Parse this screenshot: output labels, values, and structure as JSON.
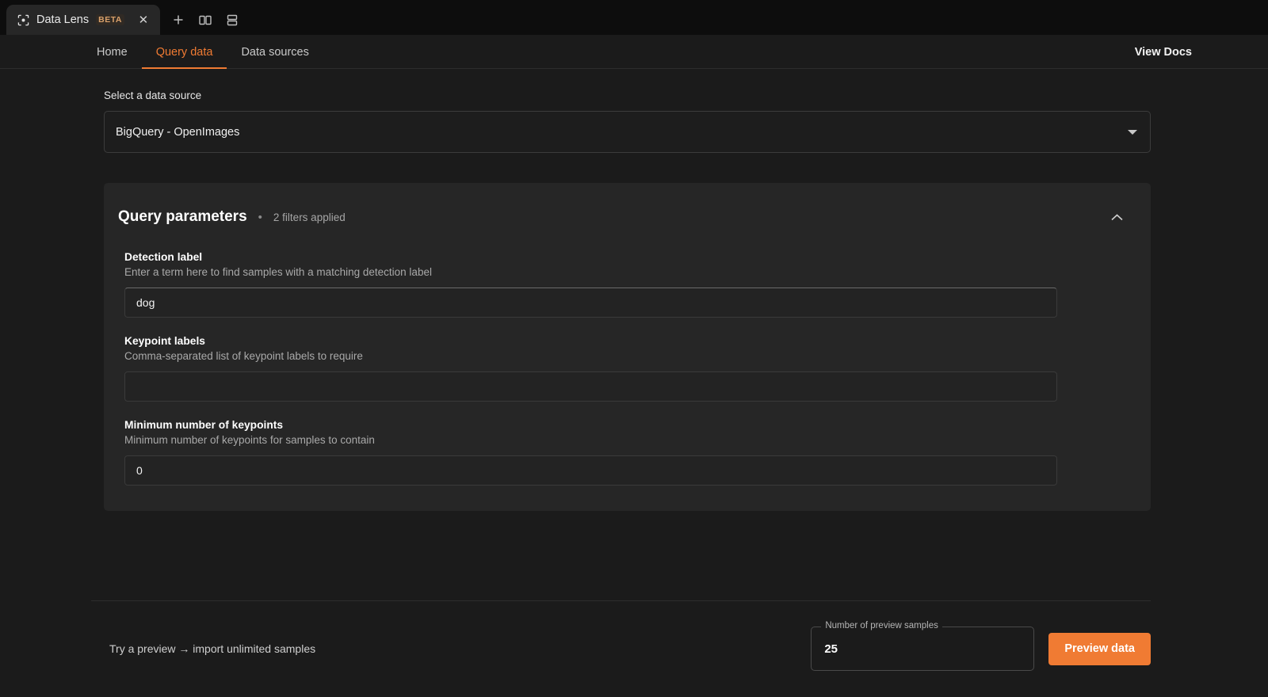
{
  "browser": {
    "tab": {
      "favicon": "scan-frame-icon",
      "title": "Data Lens",
      "badge": "BETA",
      "close": "✕"
    },
    "actions": {
      "new_tab": "+",
      "split_vertical": "split-vertical-icon",
      "split_horizontal": "split-horizontal-icon"
    }
  },
  "nav": {
    "tabs": [
      {
        "label": "Home",
        "active": false
      },
      {
        "label": "Query data",
        "active": true
      },
      {
        "label": "Data sources",
        "active": false
      }
    ],
    "docs_link": "View Docs"
  },
  "datasource": {
    "label": "Select a data source",
    "selected": "BigQuery - OpenImages"
  },
  "panel": {
    "title": "Query parameters",
    "separator": "•",
    "subtitle": "2 filters applied",
    "collapse_icon": "chevron-up-icon",
    "fields": [
      {
        "label": "Detection label",
        "help": "Enter a term here to find samples with a matching detection label",
        "value": "dog",
        "placeholder": ""
      },
      {
        "label": "Keypoint labels",
        "help": "Comma-separated list of keypoint labels to require",
        "value": "",
        "placeholder": ""
      },
      {
        "label": "Minimum number of keypoints",
        "help": "Minimum number of keypoints for samples to contain",
        "value": "0",
        "placeholder": ""
      }
    ]
  },
  "footer": {
    "note": "Try a preview → import unlimited samples",
    "samples_legend": "Number of preview samples",
    "samples_value": "25",
    "preview_button": "Preview data"
  },
  "colors": {
    "accent": "#f07b33",
    "page_bg": "#1b1b1b",
    "panel_bg": "#262626",
    "chrome_bg": "#0d0d0d",
    "badge_text": "#d9a06a"
  }
}
